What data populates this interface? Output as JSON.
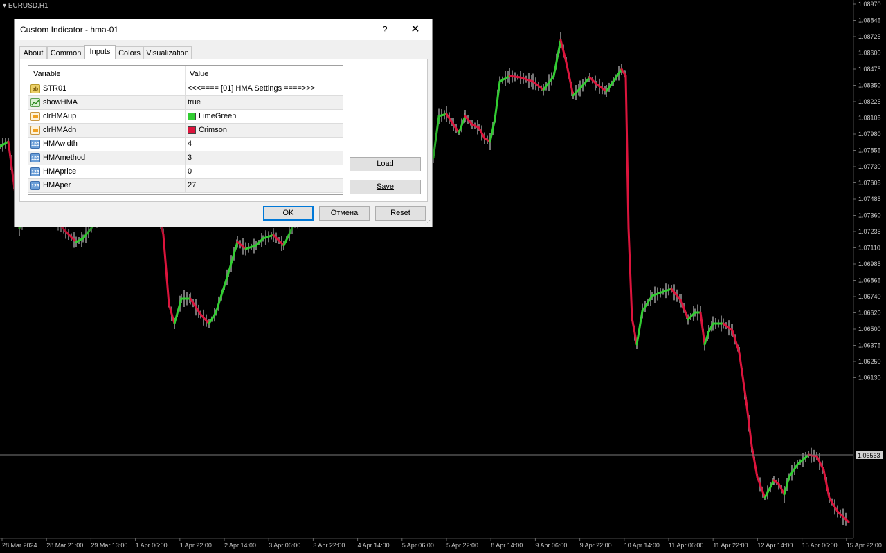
{
  "chart": {
    "symbol": "EURUSD,H1",
    "price_levels": [
      "1.08970",
      "1.08845",
      "1.08725",
      "1.08600",
      "1.08475",
      "1.08350",
      "1.08225",
      "1.08105",
      "1.07980",
      "1.07855",
      "1.07730",
      "1.07605",
      "1.07485",
      "1.07360",
      "1.07235",
      "1.07110",
      "1.06985",
      "1.06865",
      "1.06740",
      "1.06620",
      "1.06500",
      "1.06375",
      "1.06250",
      "1.06130"
    ],
    "current_price": "1.06563",
    "time_labels": [
      "28 Mar 2024",
      "28 Mar 21:00",
      "29 Mar 13:00",
      "1 Apr 06:00",
      "1 Apr 22:00",
      "2 Apr 14:00",
      "3 Apr 06:00",
      "3 Apr 22:00",
      "4 Apr 14:00",
      "5 Apr 06:00",
      "5 Apr 22:00",
      "8 Apr 14:00",
      "9 Apr 06:00",
      "9 Apr 22:00",
      "10 Apr 14:00",
      "11 Apr 06:00",
      "11 Apr 22:00",
      "12 Apr 14:00",
      "15 Apr 06:00",
      "15 Apr 22:00"
    ],
    "colors": {
      "up": "#32cd32",
      "down": "#dc143c",
      "candle": "#9a9a9a",
      "axis_text": "#c8c8c8",
      "background": "#000000"
    }
  },
  "dialog": {
    "title": "Custom Indicator - hma-01",
    "help_label": "?",
    "close_label": "✕",
    "tabs": [
      "About",
      "Common",
      "Inputs",
      "Colors",
      "Visualization"
    ],
    "active_tab": "Inputs",
    "table": {
      "headers": {
        "variable": "Variable",
        "value": "Value"
      },
      "rows": [
        {
          "icon": "string-icon",
          "icon_text": "ab",
          "variable": "STR01",
          "value": "<<<==== [01] HMA Settings ====>>>"
        },
        {
          "icon": "bool-icon",
          "icon_text": "",
          "variable": "showHMA",
          "value": "true"
        },
        {
          "icon": "color-icon",
          "icon_text": "",
          "variable": "clrHMAup",
          "value": "LimeGreen",
          "swatch": "#32cd32"
        },
        {
          "icon": "color-icon",
          "icon_text": "",
          "variable": "clrHMAdn",
          "value": "Crimson",
          "swatch": "#dc143c"
        },
        {
          "icon": "number-icon",
          "icon_text": "123",
          "variable": "HMAwidth",
          "value": "4"
        },
        {
          "icon": "number-icon",
          "icon_text": "123",
          "variable": "HMAmethod",
          "value": "3"
        },
        {
          "icon": "number-icon",
          "icon_text": "123",
          "variable": "HMAprice",
          "value": "0"
        },
        {
          "icon": "number-icon",
          "icon_text": "123",
          "variable": "HMAper",
          "value": "27"
        }
      ]
    },
    "buttons": {
      "load": "Load",
      "save": "Save",
      "ok": "OK",
      "cancel": "Отмена",
      "reset": "Reset"
    }
  }
}
